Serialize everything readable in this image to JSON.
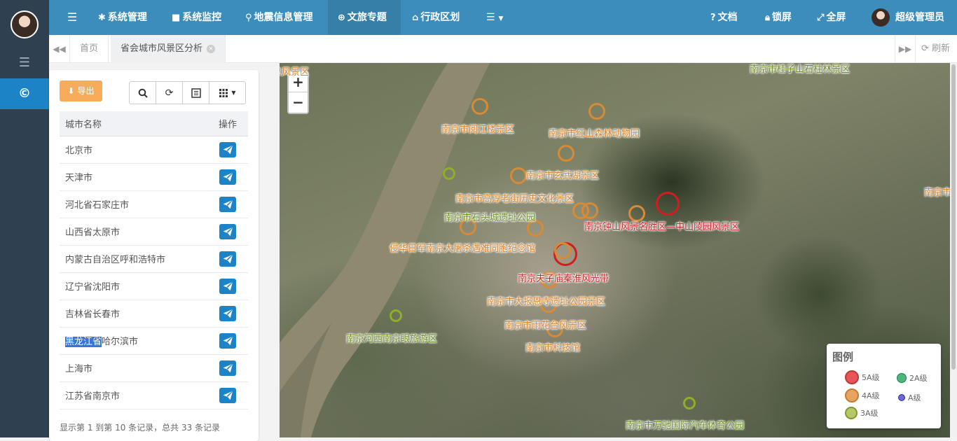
{
  "topbar": {
    "nav": [
      {
        "icon": "gear-icon",
        "label": "系统管理"
      },
      {
        "icon": "video-camera-icon",
        "label": "系统监控"
      },
      {
        "icon": "map-marker-icon",
        "label": "地震信息管理"
      },
      {
        "icon": "globe-icon",
        "label": "文旅专题",
        "active": true
      },
      {
        "icon": "bank-icon",
        "label": "行政区划"
      }
    ],
    "right": {
      "docs_label": "文档",
      "lock_label": "锁屏",
      "fullscreen_label": "全屏",
      "user_label": "超级管理员"
    }
  },
  "tabs": {
    "home_label": "首页",
    "active_label": "省会城市风景区分析",
    "close_glyph": "×",
    "refresh_label": "刷新"
  },
  "panel": {
    "export_label": "导出",
    "columns": {
      "name": "城市名称",
      "op": "操作"
    },
    "rows": [
      {
        "name": "北京市"
      },
      {
        "name": "天津市"
      },
      {
        "name": "河北省石家庄市"
      },
      {
        "name": "山西省太原市"
      },
      {
        "name": "内蒙古自治区呼和浩特市"
      },
      {
        "name": "辽宁省沈阳市"
      },
      {
        "name": "吉林省长春市"
      },
      {
        "name_highlight": "黑龙江省",
        "name_rest": "哈尔滨市"
      },
      {
        "name": "上海市"
      },
      {
        "name": "江苏省南京市"
      }
    ],
    "pager_info": "显示第 1 到第 10 条记录，总共 33 条记录"
  },
  "map": {
    "zoom_in": "+",
    "zoom_out": "−",
    "labels": {
      "l1": "南京市桂子山石柱林景区",
      "l2": "南京市阅江楼景区",
      "l3": "南京市红山森林动物园",
      "l4": "南京市玄武湖景区",
      "l5": "南京市高淳老街历史文化景区",
      "l6": "南京市石头城遗址公园",
      "l7": "南京钟山风景名胜区—中山陵园风景区",
      "l8": "侵华日军南京大屠杀遇难同胞纪念馆",
      "l9": "南京夫子庙秦淮风光带",
      "l10": "南京市大报恩寺遗址公园景区",
      "l11": "南京市雨花台风景区",
      "l12": "南京河西南京眼旅游区",
      "l13": "南京市科技馆",
      "l14": "南京市万驰国际汽车体育公园",
      "l15": "南京市",
      "l16": "泉风景区"
    },
    "legend": {
      "title": "图例",
      "items": [
        {
          "label": "5A级",
          "color": "#e74c3c"
        },
        {
          "label": "2A级",
          "color": "#27ae60"
        },
        {
          "label": "4A级",
          "color": "#e08e3a"
        },
        {
          "label": "A级",
          "color": "#3a44c2"
        },
        {
          "label": "3A级",
          "color": "#9ab538"
        }
      ]
    }
  }
}
